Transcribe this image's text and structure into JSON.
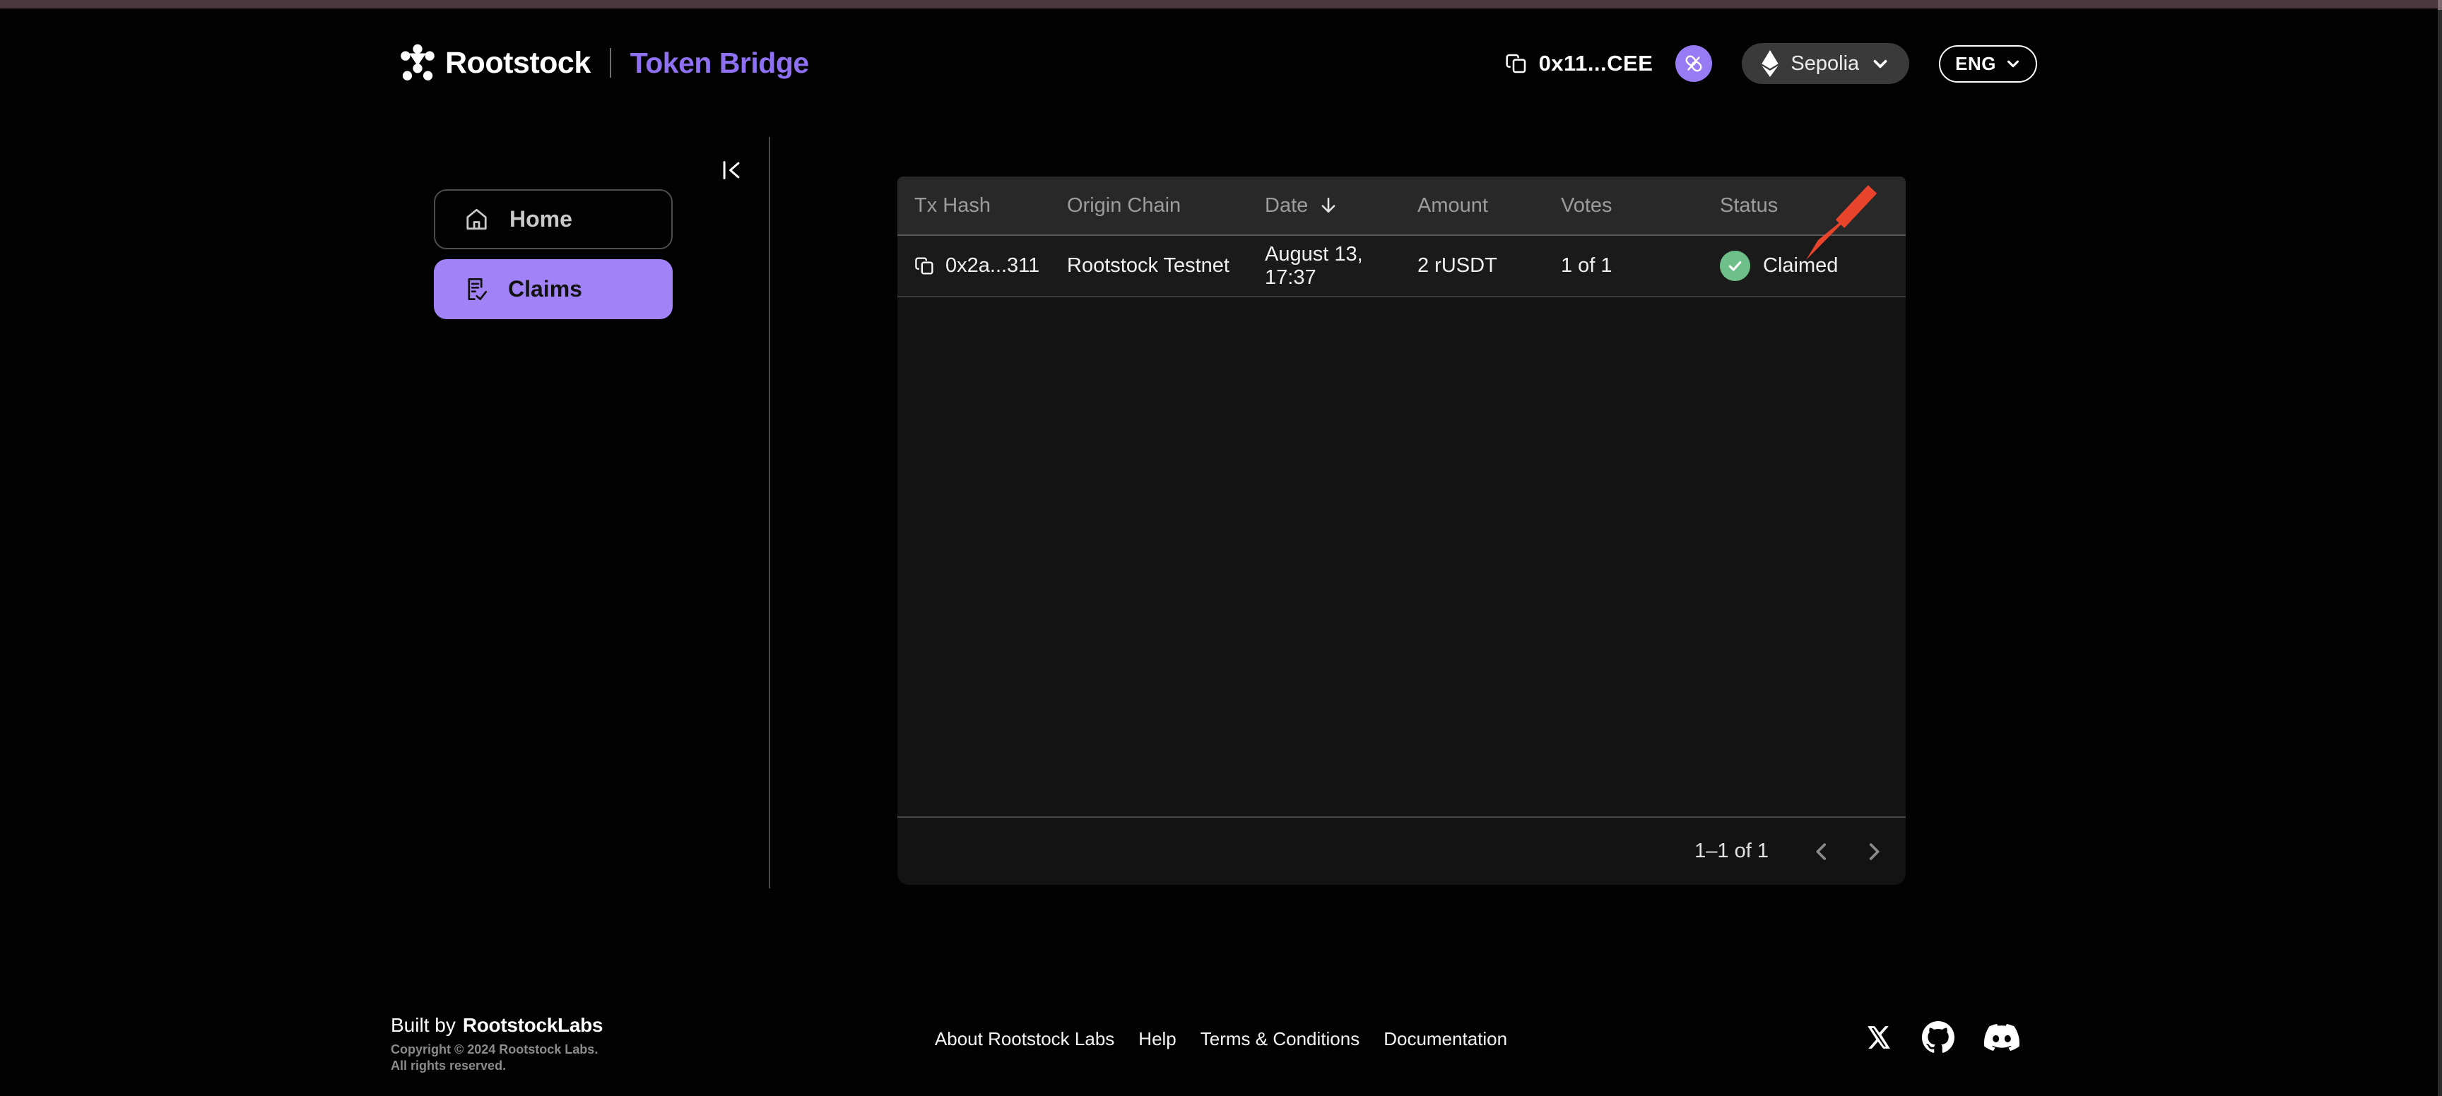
{
  "colors": {
    "accent_purple": "#a183f7",
    "brand_text_purple": "#8f70f3",
    "status_green": "#6fbf8a",
    "annotation_red": "#e8442b",
    "top_strip": "#4a363c"
  },
  "header": {
    "brand": "Rootstock",
    "product": "Token Bridge",
    "wallet_address": "0x11...CEE",
    "network": "Sepolia",
    "language": "ENG"
  },
  "sidebar": {
    "items": [
      {
        "label": "Home",
        "active": false
      },
      {
        "label": "Claims",
        "active": true
      }
    ]
  },
  "table": {
    "columns": [
      "Tx Hash",
      "Origin Chain",
      "Date",
      "Amount",
      "Votes",
      "Status"
    ],
    "sorted_column": "Date",
    "sort_direction": "desc",
    "rows": [
      {
        "tx_hash": "0x2a...311",
        "origin_chain": "Rootstock Testnet",
        "date": "August 13, 17:37",
        "amount": "2 rUSDT",
        "votes": "1 of 1",
        "status": "Claimed"
      }
    ],
    "pagination": {
      "range_label": "1–1 of 1"
    }
  },
  "footer": {
    "built_by_prefix": "Built by",
    "built_by_brand": "RootstockLabs",
    "copyright_line1": "Copyright © 2024 Rootstock Labs.",
    "copyright_line2": "All rights reserved.",
    "links": [
      {
        "label": "About Rootstock Labs"
      },
      {
        "label": "Help"
      },
      {
        "label": "Terms & Conditions"
      },
      {
        "label": "Documentation"
      }
    ]
  },
  "icons": {
    "copy": "⧉",
    "disconnect": "link-off",
    "network": "ethereum-diamond",
    "chevron_down": "⌄",
    "collapse": "|<",
    "home": "⌂",
    "claims": "file-check",
    "sort_desc": "↓",
    "status_check": "✓",
    "prev": "‹",
    "next": "›",
    "socials": [
      "x",
      "github",
      "discord"
    ]
  }
}
